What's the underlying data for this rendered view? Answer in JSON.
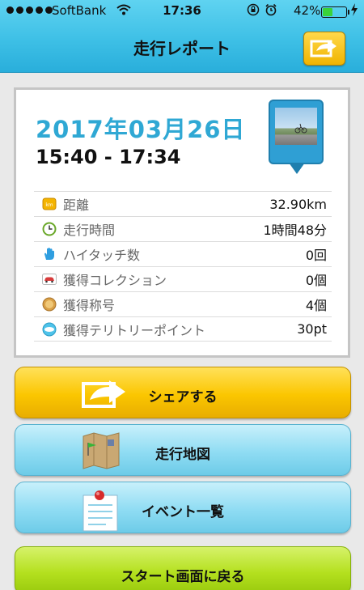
{
  "status_bar": {
    "carrier": "SoftBank",
    "time": "17:36",
    "battery_percent": "42%",
    "battery_level": 0.42
  },
  "nav": {
    "title": "走行レポート"
  },
  "report": {
    "date": "2017年03月26日",
    "time_range": "15:40 - 17:34",
    "stats": [
      {
        "icon": "km-badge-icon",
        "label": "距離",
        "value": "32.90km"
      },
      {
        "icon": "clock-icon",
        "label": "走行時間",
        "value": "1時間48分"
      },
      {
        "icon": "hand-icon",
        "label": "ハイタッチ数",
        "value": "0回"
      },
      {
        "icon": "car-card-icon",
        "label": "獲得コレクション",
        "value": "0個"
      },
      {
        "icon": "medal-icon",
        "label": "獲得称号",
        "value": "4個"
      },
      {
        "icon": "spot-icon",
        "label": "獲得テリトリーポイント",
        "value": "30pt"
      }
    ]
  },
  "buttons": {
    "share": "シェアする",
    "map": "走行地図",
    "events": "イベント一覧",
    "back_to_start": "スタート画面に戻る"
  },
  "colors": {
    "header": "#3ec0e6",
    "accent_date": "#2fa8d4",
    "share_button": "#fbc600",
    "blue_button": "#8fdcf3",
    "green_button": "#b4e01e"
  }
}
